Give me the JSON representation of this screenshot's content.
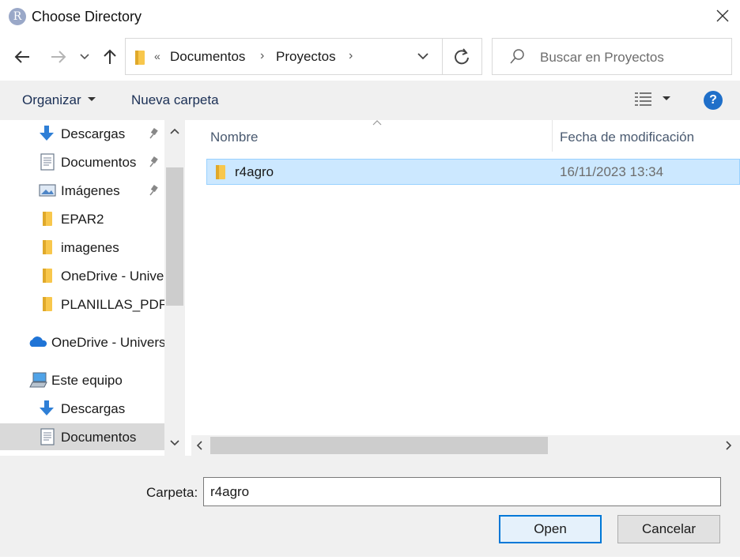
{
  "window": {
    "title": "Choose Directory",
    "app_icon_letter": "R"
  },
  "nav": {
    "back_icon": "arrow-left-icon",
    "forward_icon": "arrow-right-icon",
    "recent_icon": "chevron-down-icon",
    "up_icon": "arrow-up-icon",
    "address": {
      "overflow": "«",
      "crumbs": [
        "Documentos",
        "Proyectos"
      ]
    },
    "search_placeholder": "Buscar en Proyectos"
  },
  "toolbar": {
    "organize_label": "Organizar",
    "new_folder_label": "Nueva carpeta",
    "help_label": "?"
  },
  "sidebar": {
    "items": [
      {
        "label": "Descargas",
        "icon": "download-arrow-icon",
        "pinned": true
      },
      {
        "label": "Documentos",
        "icon": "document-icon",
        "pinned": true
      },
      {
        "label": "Imágenes",
        "icon": "picture-icon",
        "pinned": true
      },
      {
        "label": "EPAR2",
        "icon": "folder-icon"
      },
      {
        "label": "imagenes",
        "icon": "folder-icon"
      },
      {
        "label": "OneDrive - Unive",
        "icon": "folder-icon"
      },
      {
        "label": "PLANILLAS_PDFS",
        "icon": "folder-icon"
      },
      {
        "label": "OneDrive - Univers",
        "icon": "cloud-icon"
      },
      {
        "label": "Este equipo",
        "icon": "computer-icon"
      },
      {
        "label": "Descargas",
        "icon": "download-arrow-icon"
      },
      {
        "label": "Documentos",
        "icon": "document-icon",
        "selected": true
      }
    ]
  },
  "filelist": {
    "columns": {
      "name": "Nombre",
      "date": "Fecha de modificación"
    },
    "rows": [
      {
        "name": "r4agro",
        "date": "16/11/2023 13:34",
        "selected": true
      }
    ]
  },
  "footer": {
    "folder_label": "Carpeta:",
    "folder_value": "r4agro",
    "open_label": "Open",
    "cancel_label": "Cancelar"
  },
  "colors": {
    "selection_bg": "#cce8ff",
    "selection_border": "#99d1ff",
    "accent": "#0078d7",
    "help_blue": "#1f6fc9",
    "folder_yellow": "#f8c74c"
  }
}
